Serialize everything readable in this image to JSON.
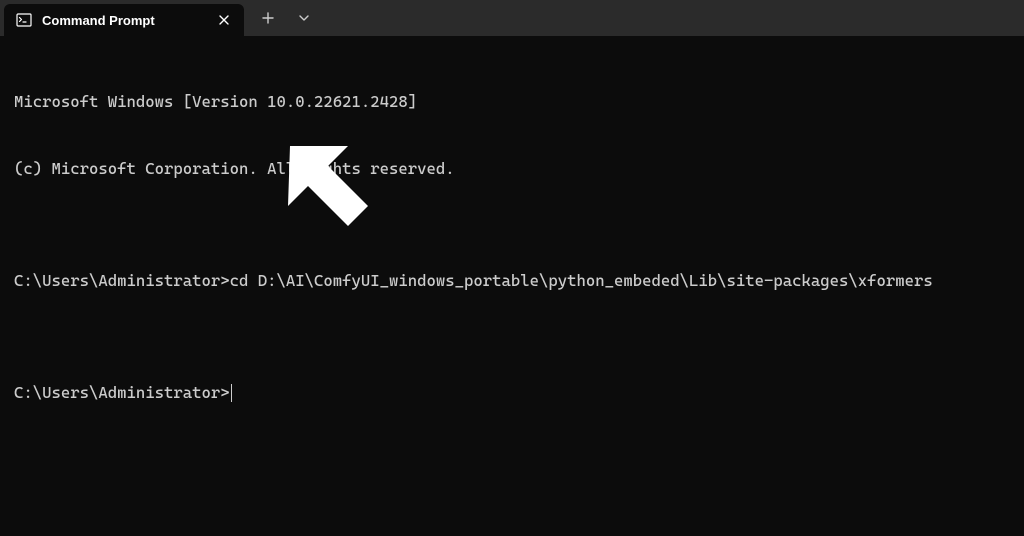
{
  "tab": {
    "title": "Command Prompt"
  },
  "terminal": {
    "line1": "Microsoft Windows [Version 10.0.22621.2428]",
    "line2": "(c) Microsoft Corporation. All rights reserved.",
    "blank1": "",
    "prompt1_path": "C:\\Users\\Administrator>",
    "prompt1_cmd": "cd D:\\AI\\ComfyUI_windows_portable\\python_embeded\\Lib\\site-packages\\xformers",
    "blank2": "",
    "prompt2_path": "C:\\Users\\Administrator>"
  }
}
